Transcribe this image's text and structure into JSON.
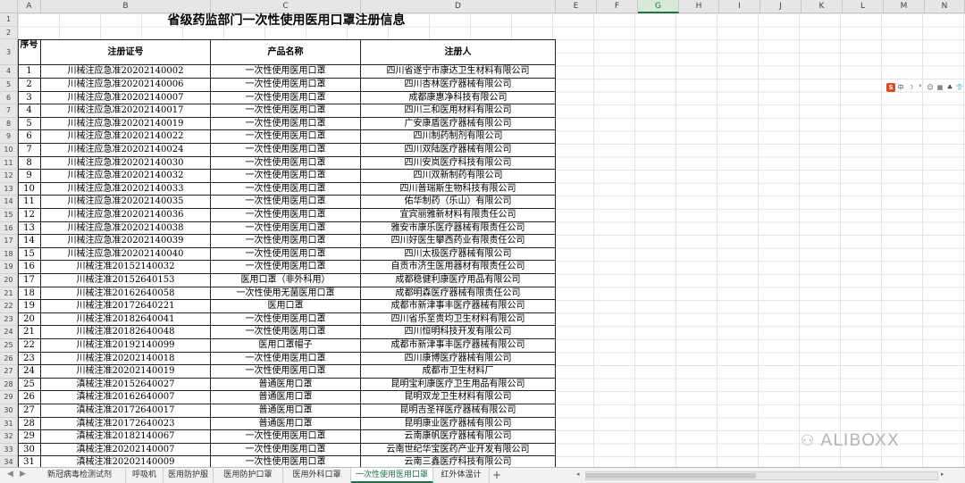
{
  "columns": [
    "A",
    "B",
    "C",
    "D",
    "E",
    "F",
    "G",
    "H",
    "I",
    "J",
    "K",
    "L",
    "M",
    "N"
  ],
  "selected_column": "G",
  "title": "省级药监部门一次性使用医用口罩注册信息",
  "headers": {
    "seq": "序号",
    "cert": "注册证号",
    "product": "产品名称",
    "registrant": "注册人"
  },
  "rows": [
    [
      "1",
      "川械注应急准20202140002",
      "一次性使用医用口罩",
      "四川省遂宁市康达卫生材料有限公司"
    ],
    [
      "2",
      "川械注应急准20202140006",
      "一次性使用医用口罩",
      "四川杏林医疗器械有限公司"
    ],
    [
      "3",
      "川械注应急准20202140007",
      "一次性使用医用口罩",
      "成都康惠净科技有限公司"
    ],
    [
      "4",
      "川械注应急准20202140017",
      "一次性使用医用口罩",
      "四川三和医用材料有限公司"
    ],
    [
      "5",
      "川械注应急准20202140019",
      "一次性使用医用口罩",
      "广安康盾医疗器械有限公司"
    ],
    [
      "6",
      "川械注应急准20202140022",
      "一次性使用医用口罩",
      "四川制药制剂有限公司"
    ],
    [
      "7",
      "川械注应急准20202140024",
      "一次性使用医用口罩",
      "四川双陆医疗器械有限公司"
    ],
    [
      "8",
      "川械注应急准20202140030",
      "一次性使用医用口罩",
      "四川安岚医疗科技有限公司"
    ],
    [
      "9",
      "川械注应急准20202140032",
      "一次性使用医用口罩",
      "四川双新制药有限公司"
    ],
    [
      "10",
      "川械注应急准20202140033",
      "一次性使用医用口罩",
      "四川普瑞斯生物科技有限公司"
    ],
    [
      "11",
      "川械注应急准20202140035",
      "一次性使用医用口罩",
      "佑华制药（乐山）有限公司"
    ],
    [
      "12",
      "川械注应急准20202140036",
      "一次性使用医用口罩",
      "宜宾丽雅新材料有限责任公司"
    ],
    [
      "13",
      "川械注应急准20202140038",
      "一次性使用医用口罩",
      "雅安市康乐医疗器械有限责任公司"
    ],
    [
      "14",
      "川械注应急准20202140039",
      "一次性使用医用口罩",
      "四川好医生攀西药业有限责任公司"
    ],
    [
      "15",
      "川械注应急准20202140040",
      "一次性使用医用口罩",
      "四川太极医疗器械有限公司"
    ],
    [
      "16",
      "川械注准20152140032",
      "一次性使用医用口罩",
      "自贡市济生医用器材有限责任公司"
    ],
    [
      "17",
      "川械注准20152640153",
      "医用口罩（非外科用）",
      "成都稳健利康医疗用品有限公司"
    ],
    [
      "18",
      "川械注准20162640058",
      "一次性使用无菌医用口罩",
      "成都明森医疗器械有限责任公司"
    ],
    [
      "19",
      "川械注准20172640221",
      "医用口罩",
      "成都市新津事丰医疗器械有限公司"
    ],
    [
      "20",
      "川械注准20182640041",
      "一次性使用医用口罩",
      "四川省乐至贵均卫生材料有限公司"
    ],
    [
      "21",
      "川械注准20182640048",
      "一次性使用医用口罩",
      "四川恒明科技开发有限公司"
    ],
    [
      "22",
      "川械注准20192140099",
      "医用口罩帽子",
      "成都市新津事丰医疗器械有限公司"
    ],
    [
      "23",
      "川械注准20202140018",
      "一次性使用医用口罩",
      "四川康博医疗器械有限公司"
    ],
    [
      "24",
      "川械注准20202140019",
      "一次性使用医用口罩",
      "成都市卫生材料厂"
    ],
    [
      "25",
      "滇械注准20152640027",
      "普通医用口罩",
      "昆明宝利康医疗卫生用品有限公司"
    ],
    [
      "26",
      "滇械注准20162640007",
      "普通医用口罩",
      "昆明双龙卫生材料有限公司"
    ],
    [
      "27",
      "滇械注准20172640017",
      "普通医用口罩",
      "昆明吉圣祥医疗器械有限公司"
    ],
    [
      "28",
      "滇械注准20172640023",
      "普通医用口罩",
      "昆明康业医疗器械有限公司"
    ],
    [
      "29",
      "滇械注准20182140067",
      "一次性使用医用口罩",
      "云南康帆医疗器械有限公司"
    ],
    [
      "30",
      "滇械注准20202140007",
      "一次性使用医用口罩",
      "云南世纪华宝医药产业开发有限公司"
    ],
    [
      "31",
      "滇械注准20202140009",
      "一次性使用医用口罩",
      "云南三鑫医疗科技有限公司"
    ]
  ],
  "sheet_tabs": [
    "新冠病毒检测试剂",
    "呼吸机",
    "医用防护服",
    "医用防护口罩",
    "医用外科口罩",
    "一次性使用医用口罩",
    "红外体温计"
  ],
  "active_tab_index": 5,
  "add_tab_label": "+",
  "tab_nav": [
    "◀",
    "▶"
  ],
  "floating_toolbar": [
    "S",
    "中",
    "☽",
    "°",
    "☺",
    "▦",
    "♣",
    "👕",
    "⚙"
  ],
  "watermark": "ALIBOXX",
  "colors": {
    "accent": "#217346",
    "header_bg": "#e6e6e6",
    "tool_logo": "#e04a1f"
  }
}
